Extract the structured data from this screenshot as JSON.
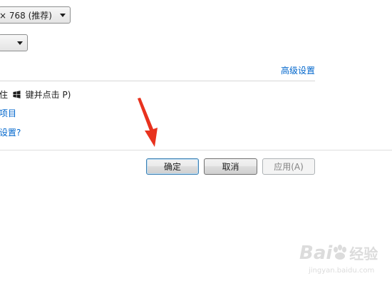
{
  "display": {
    "resolution_value": "× 768 (推荐)",
    "second_dropdown_value": ""
  },
  "links": {
    "advanced_settings": "高级设置",
    "items_link": "项目",
    "settings_link": "设置?"
  },
  "tip": {
    "prefix": "住",
    "suffix": "键并点击 P)"
  },
  "buttons": {
    "ok": "确定",
    "cancel": "取消",
    "apply": "应用(A)"
  },
  "watermark": {
    "brand_text": "Bai",
    "brand_text2": "经验",
    "url": "jingyan.baidu.com"
  },
  "colors": {
    "link": "#0066cc",
    "arrow": "#e8321e",
    "primary_border": "#3c7fb1"
  },
  "icons": {
    "windows_key": "windows-logo-icon",
    "annotation_arrow": "red-arrow-icon"
  }
}
